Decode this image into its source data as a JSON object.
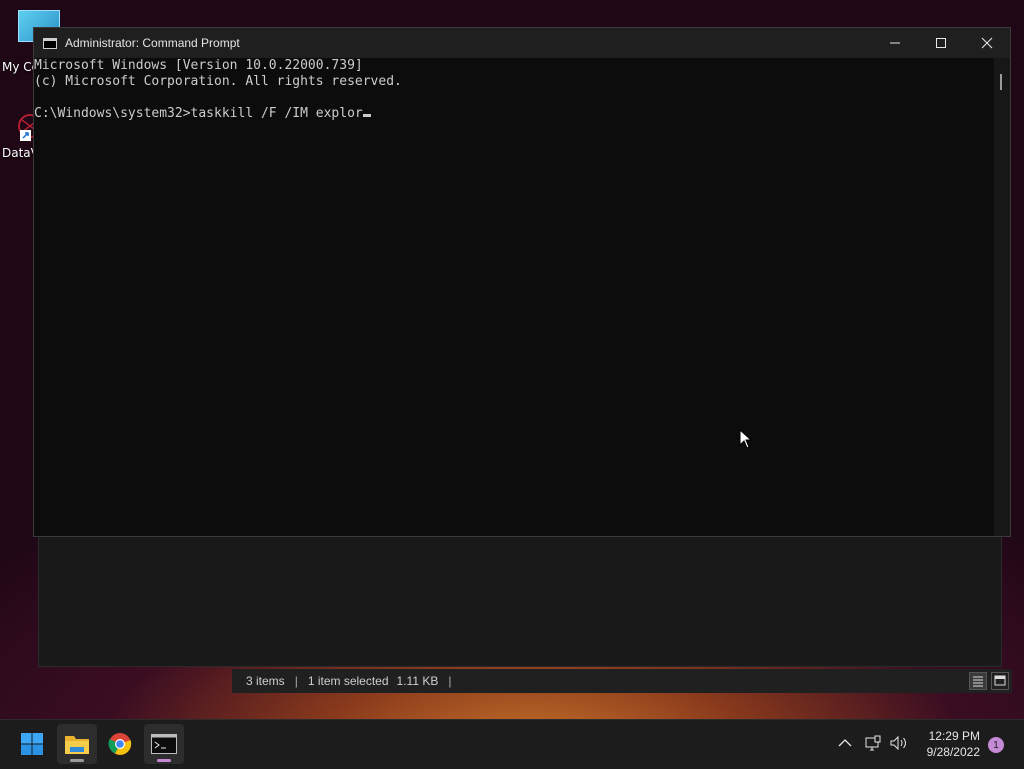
{
  "desktop": {
    "icons": [
      {
        "label": "My Co",
        "icon": "computer-icon"
      },
      {
        "label": "DataV",
        "icon": "app-shortcut-icon"
      }
    ]
  },
  "cmd": {
    "title": "Administrator: Command Prompt",
    "lines": [
      "Microsoft Windows [Version 10.0.22000.739]",
      "(c) Microsoft Corporation. All rights reserved.",
      "",
      "C:\\Windows\\system32>taskkill /F /IM explor"
    ],
    "controls": {
      "minimize": "—",
      "maximize": "☐",
      "close": "✕"
    }
  },
  "explorer_status": {
    "items": "3 items",
    "selected": "1 item selected",
    "size": "1.11 KB",
    "sep": "|"
  },
  "taskbar": {
    "apps": [
      {
        "name": "start",
        "icon": "windows-start-icon"
      },
      {
        "name": "file-explorer",
        "icon": "folder-icon"
      },
      {
        "name": "chrome",
        "icon": "chrome-icon"
      },
      {
        "name": "command-prompt",
        "icon": "terminal-icon"
      }
    ],
    "tray": {
      "chevron": "^",
      "time": "12:29 PM",
      "date": "9/28/2022",
      "notifications": "1"
    }
  },
  "colors": {
    "accent_start": "#2b9ff0",
    "folder_yellow": "#f4c542",
    "console_bg": "#0c0c0c",
    "console_fg": "#cccccc"
  }
}
